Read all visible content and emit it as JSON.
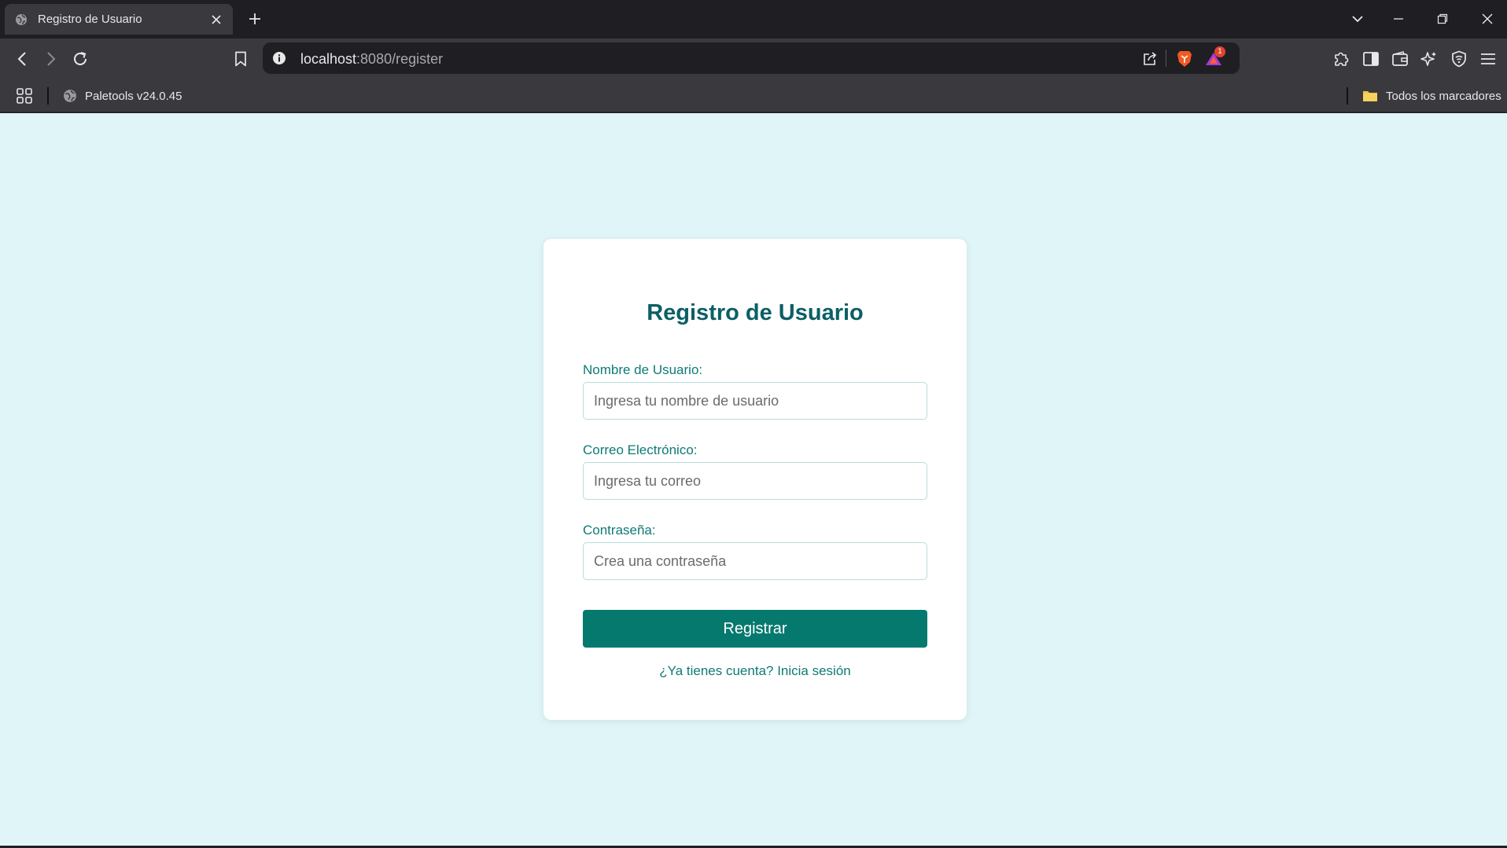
{
  "browser": {
    "tab": {
      "title": "Registro de Usuario"
    },
    "address_bar": {
      "host": "localhost",
      "rest": ":8080/register"
    },
    "notification_badge": "1",
    "bookmarks": [
      {
        "label": "Paletools v24.0.45"
      }
    ],
    "all_bookmarks_label": "Todos los marcadores"
  },
  "form": {
    "title": "Registro de Usuario",
    "username": {
      "label": "Nombre de Usuario:",
      "placeholder": "Ingresa tu nombre de usuario",
      "value": ""
    },
    "email": {
      "label": "Correo Electrónico:",
      "placeholder": "Ingresa tu correo",
      "value": ""
    },
    "password": {
      "label": "Contraseña:",
      "placeholder": "Crea una contraseña",
      "value": ""
    },
    "submit_label": "Registrar",
    "login_link": "¿Ya tienes cuenta? Inicia sesión"
  },
  "colors": {
    "page_background": "#dff5f7",
    "title": "#0b5f66",
    "accent": "#06796e",
    "label": "#0e7a74"
  }
}
